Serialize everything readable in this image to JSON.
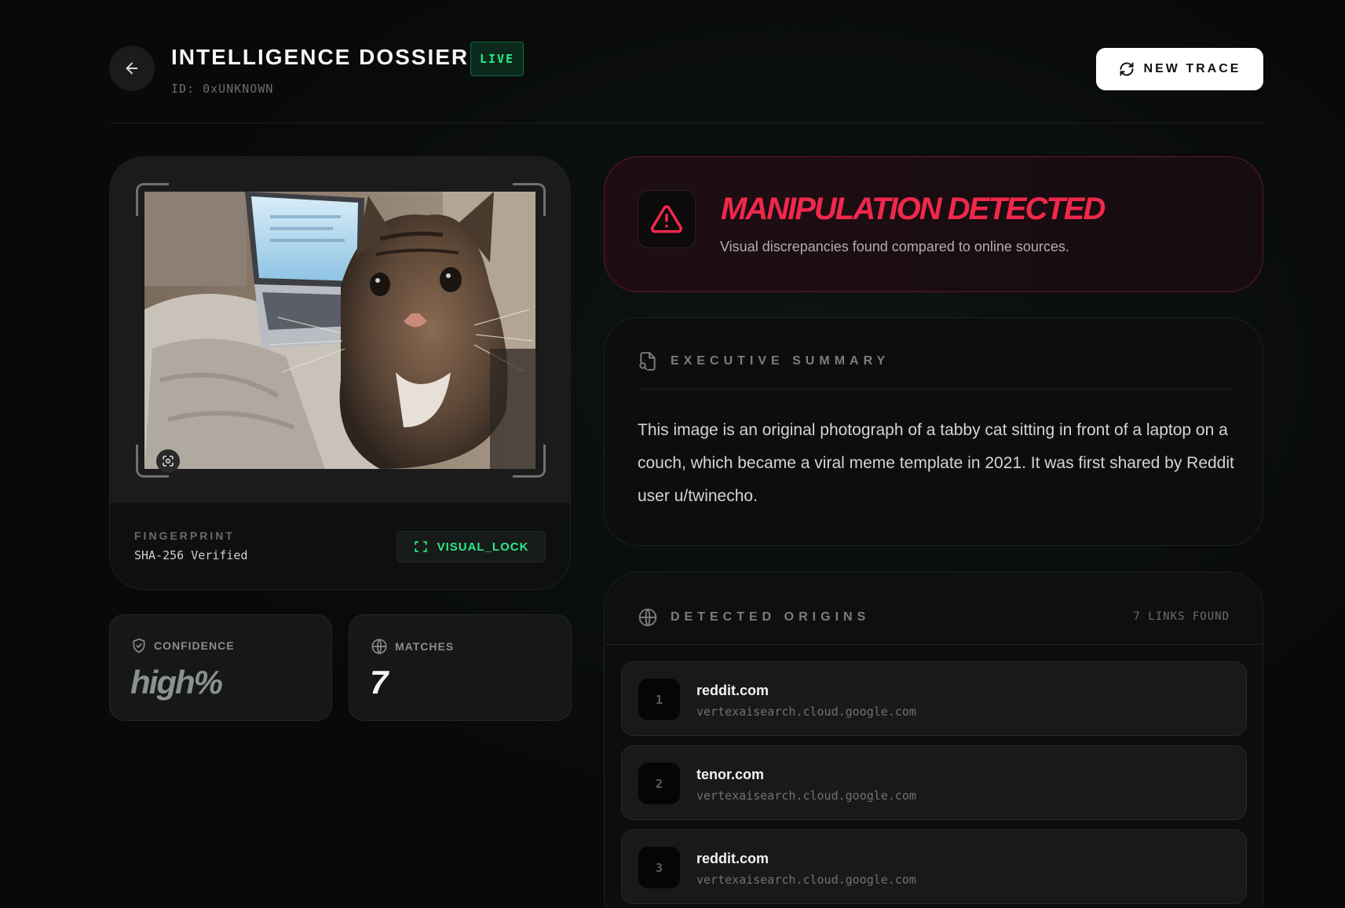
{
  "header": {
    "title": "INTELLIGENCE DOSSIER",
    "status_badge": "LIVE",
    "doc_id": "ID: 0xUNKNOWN",
    "new_trace_label": "NEW TRACE"
  },
  "image_panel": {
    "fingerprint_label": "FINGERPRINT",
    "fingerprint_value": "SHA-256 Verified",
    "lock_label": "VISUAL_LOCK"
  },
  "stats": {
    "confidence": {
      "label": "CONFIDENCE",
      "value": "high%"
    },
    "matches": {
      "label": "MATCHES",
      "value": "7"
    }
  },
  "alert": {
    "title": "MANIPULATION DETECTED",
    "message": "Visual discrepancies found compared to online sources."
  },
  "summary": {
    "heading": "EXECUTIVE SUMMARY",
    "text": "This image is an original photograph of a tabby cat sitting in front of a laptop on a couch, which became a viral meme template in 2021. It was first shared by Reddit user u/twinecho."
  },
  "origins": {
    "heading": "DETECTED ORIGINS",
    "count_label": "7 LINKS FOUND",
    "items": [
      {
        "index": "1",
        "domain": "reddit.com",
        "source": "vertexaisearch.cloud.google.com"
      },
      {
        "index": "2",
        "domain": "tenor.com",
        "source": "vertexaisearch.cloud.google.com"
      },
      {
        "index": "3",
        "domain": "reddit.com",
        "source": "vertexaisearch.cloud.google.com"
      }
    ]
  },
  "colors": {
    "accent_green": "#2ee887",
    "alert_red": "#f0284c",
    "background": "#080a09"
  },
  "icons": [
    "arrow-left-icon",
    "refresh-icon",
    "warning-triangle-icon",
    "document-search-icon",
    "globe-icon",
    "shield-check-icon",
    "scan-frame-icon",
    "camera-scan-icon"
  ]
}
